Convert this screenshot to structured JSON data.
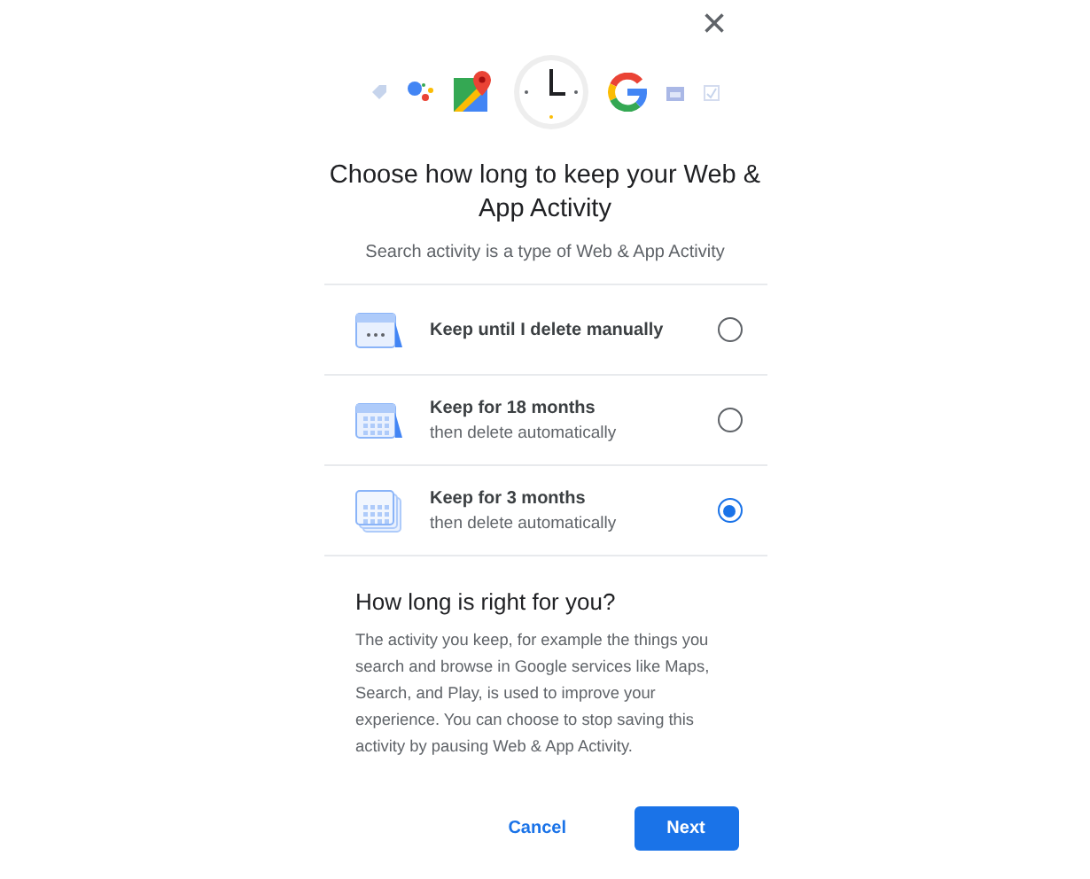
{
  "close_button": {
    "label": "×"
  },
  "title": "Choose how long to keep your Web & App Activity",
  "subtitle": "Search activity is a type of Web & App Activity",
  "options": [
    {
      "label": "Keep until I delete manually",
      "selected": false
    },
    {
      "label": "Keep for 18 months",
      "detail": "then delete automatically",
      "selected": false
    },
    {
      "label": "Keep for 3 months",
      "detail": "then delete automatically",
      "selected": true
    }
  ],
  "info": {
    "heading": "How long is right for you?",
    "body": "The activity you keep, for example the things you search and browse in Google services like Maps, Search, and Play, is used to improve your experience. You can choose to stop saving this activity by pausing Web & App Activity."
  },
  "buttons": [
    {
      "label": "Cancel",
      "kind": "text"
    },
    {
      "label": "Next",
      "kind": "filled"
    }
  ]
}
